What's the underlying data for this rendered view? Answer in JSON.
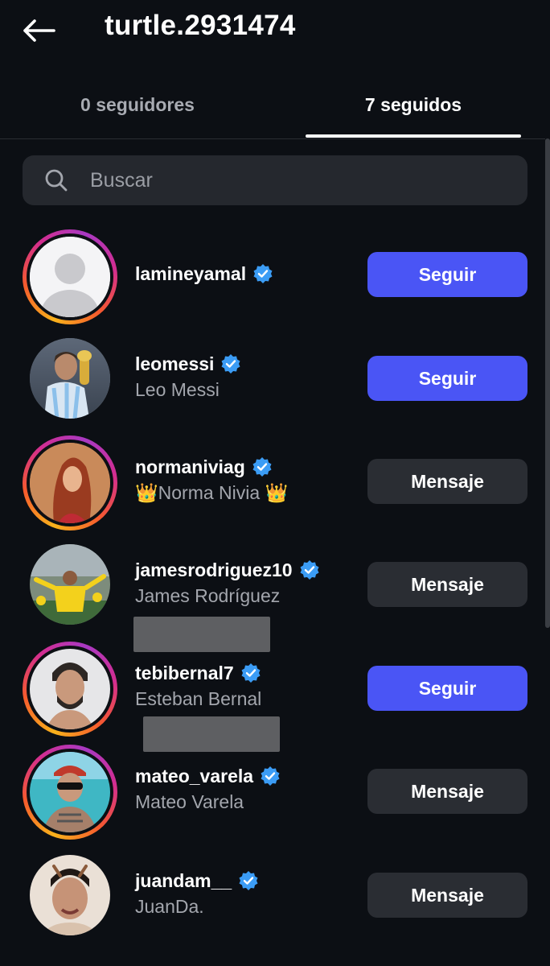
{
  "header": {
    "title": "turtle.2931474",
    "back_icon": "arrow-left-icon"
  },
  "tabs": [
    {
      "label": "0 seguidores",
      "active": false
    },
    {
      "label": "7 seguidos",
      "active": true
    }
  ],
  "search": {
    "placeholder": "Buscar",
    "value": "",
    "icon": "search-icon"
  },
  "colors": {
    "background": "#0c0f14",
    "follow_button": "#4a55f5",
    "message_button": "#2a2d33",
    "verified_badge": "#3b9cf5"
  },
  "following": [
    {
      "username": "lamineyamal",
      "full_name": "",
      "verified": true,
      "story_ring": true,
      "button": "Seguir"
    },
    {
      "username": "leomessi",
      "full_name": "Leo Messi",
      "verified": true,
      "story_ring": false,
      "button": "Seguir"
    },
    {
      "username": "normaniviag",
      "full_name": "👑Norma Nivia 👑",
      "verified": true,
      "story_ring": true,
      "button": "Mensaje"
    },
    {
      "username": "jamesrodriguez10",
      "full_name": "James Rodríguez",
      "verified": true,
      "story_ring": false,
      "button": "Mensaje"
    },
    {
      "username": "tebibernal7",
      "full_name": "Esteban Bernal",
      "verified": true,
      "story_ring": true,
      "button": "Seguir"
    },
    {
      "username": "mateo_varela",
      "full_name": "Mateo Varela",
      "verified": true,
      "story_ring": true,
      "button": "Mensaje"
    },
    {
      "username": "juandam__",
      "full_name": "JuanDa.",
      "verified": true,
      "story_ring": false,
      "button": "Mensaje"
    }
  ]
}
